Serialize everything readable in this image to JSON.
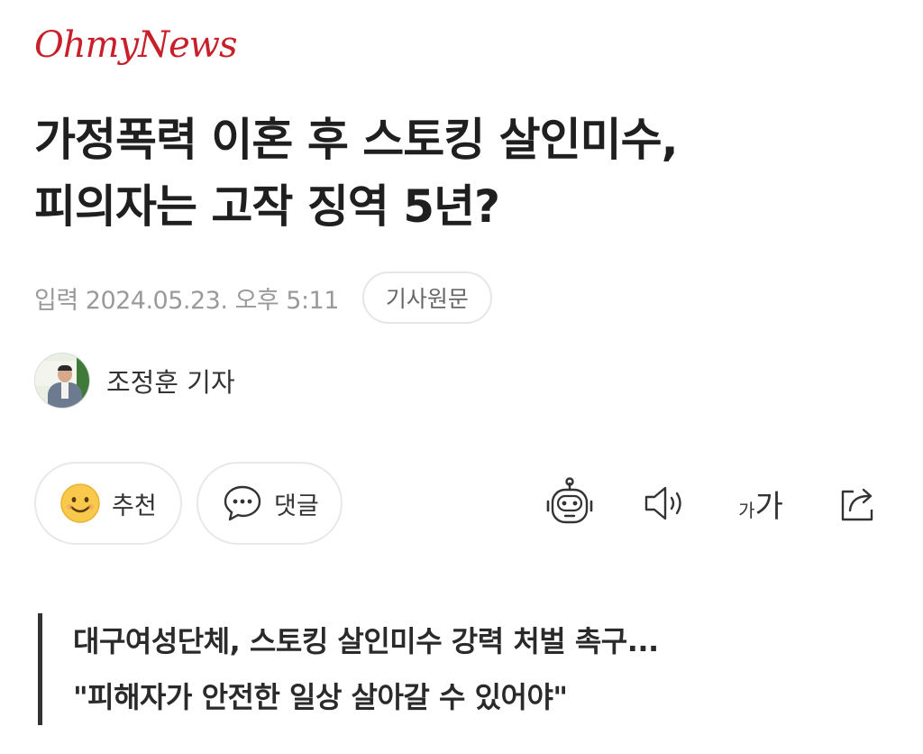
{
  "brand": {
    "logo_text": "OhmyNews",
    "logo_color": "#c8202b"
  },
  "article": {
    "headline": [
      "가정폭력 이혼 후 스토킹 살인미수,",
      "피의자는 고작 징역 5년?"
    ],
    "published": "입력 2024.05.23. 오후 5:11",
    "source_button": "기사원문",
    "reporter": "조정훈 기자",
    "subtitle": [
      "대구여성단체, 스토킹 살인미수 강력 처벌 촉구...",
      "\"피해자가 안전한 일상 살아갈 수 있어야\""
    ]
  },
  "actions": {
    "recommend_label": "추천",
    "comment_label": "댓글",
    "font_small": "가",
    "font_large": "가"
  },
  "icons": {
    "recommend": "smile-emoji-icon",
    "comment": "speech-bubble-icon",
    "summary": "robot-icon",
    "listen": "speaker-icon",
    "font_size": "font-size-icon",
    "share": "share-icon"
  },
  "colors": {
    "text_primary": "#1f1f1f",
    "text_muted": "#9a9a9a",
    "border": "#e6e6e6",
    "emoji_yellow": "#f8c94a"
  }
}
